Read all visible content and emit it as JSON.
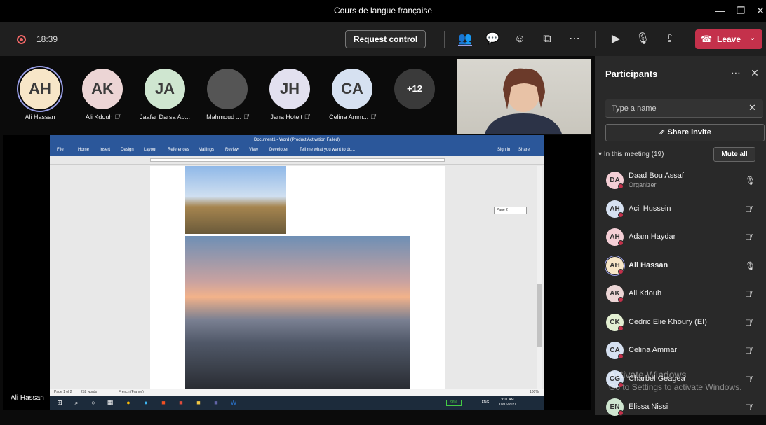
{
  "window": {
    "title": "Cours de langue française"
  },
  "toolbar": {
    "timer": "18:39",
    "request_control": "Request control",
    "leave": "Leave"
  },
  "gallery": [
    {
      "initials": "AH",
      "name": "Ali Hassan",
      "color": "#f7e6c8",
      "ring": true,
      "muted": false
    },
    {
      "initials": "AK",
      "name": "Ali Kdouh",
      "color": "#ecd5d5",
      "muted": true
    },
    {
      "initials": "JA",
      "name": "Jaafar Darsa Ab...",
      "color": "#cfe6d0",
      "muted": false
    },
    {
      "initials": "",
      "name": "Mahmoud ...",
      "color": "#555",
      "muted": true
    },
    {
      "initials": "JH",
      "name": "Jana Hoteit",
      "color": "#e2e0ef",
      "muted": true
    },
    {
      "initials": "CA",
      "name": "Celina Amm...",
      "color": "#d6e1f1",
      "muted": true
    },
    {
      "initials": "+12",
      "name": "",
      "color": "#3a3a3a",
      "muted": false
    }
  ],
  "share": {
    "presenter": "Ali Hassan",
    "word": {
      "title": "Document1 - Word (Product Activation Failed)",
      "tabs": [
        "File",
        "Home",
        "Insert",
        "Design",
        "Layout",
        "References",
        "Mailings",
        "Review",
        "View",
        "Developer"
      ],
      "tell_me": "Tell me what you want to do...",
      "sign_in": "Sign in",
      "share": "Share",
      "page_tip": "Page 2",
      "status_page": "Page 1 of 2",
      "status_words": "252 words",
      "status_lang": "French (France)",
      "zoom": "100%",
      "battery": "96%",
      "lang": "ENG",
      "time": "9:11 AM",
      "date": "10/16/2021"
    }
  },
  "panel": {
    "title": "Participants",
    "search_placeholder": "Type a name",
    "share_invite": "Share invite",
    "in_meeting": "In this meeting (19)",
    "mute_all": "Mute all",
    "participants": [
      {
        "initials": "DA",
        "name": "Daad Bou Assaf",
        "role": "Organizer",
        "color": "#f4cfd6",
        "mic": "on",
        "bold": false
      },
      {
        "initials": "AH",
        "name": "Acil Hussein",
        "role": "",
        "color": "#d6e1f1",
        "mic": "off",
        "bold": false
      },
      {
        "initials": "AH",
        "name": "Adam Haydar",
        "role": "",
        "color": "#f4cfd6",
        "mic": "off",
        "bold": false
      },
      {
        "initials": "AH",
        "name": "Ali Hassan",
        "role": "",
        "color": "#f7e6c8",
        "mic": "on",
        "bold": true
      },
      {
        "initials": "AK",
        "name": "Ali Kdouh",
        "role": "",
        "color": "#ecd5d5",
        "mic": "off",
        "bold": false
      },
      {
        "initials": "CK",
        "name": "Cedric Elie Khoury (EI)",
        "role": "",
        "color": "#e3efd2",
        "mic": "off",
        "bold": false
      },
      {
        "initials": "CA",
        "name": "Celina Ammar",
        "role": "",
        "color": "#d6e1f1",
        "mic": "off",
        "bold": false
      },
      {
        "initials": "CG",
        "name": "Charbel Geagea",
        "role": "",
        "color": "#d6e1f1",
        "mic": "off",
        "bold": false
      },
      {
        "initials": "EN",
        "name": "Elissa Nissi",
        "role": "",
        "color": "#cfe6d0",
        "mic": "off",
        "bold": false
      }
    ]
  },
  "watermark": {
    "line1": "Activate Windows",
    "line2": "Go to Settings to activate Windows."
  }
}
